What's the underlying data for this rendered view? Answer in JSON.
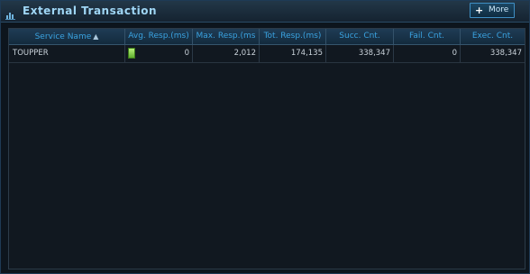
{
  "panel": {
    "title": "External Transaction",
    "more_button": {
      "icon": "plus-icon",
      "label": "More"
    }
  },
  "table": {
    "columns": [
      {
        "label": "Service Name",
        "sorted": "ascending"
      },
      {
        "label": "Avg. Resp.(ms)"
      },
      {
        "label": "Max. Resp.(ms"
      },
      {
        "label": "Tot. Resp.(ms)"
      },
      {
        "label": "Succ. Cnt."
      },
      {
        "label": "Fail. Cnt."
      },
      {
        "label": "Exec. Cnt."
      }
    ],
    "rows": [
      {
        "service_name": "TOUPPER",
        "avg_resp": "0",
        "avg_resp_bar": "green",
        "max_resp": "2,012",
        "tot_resp": "174,135",
        "succ_cnt": "338,347",
        "fail_cnt": "0",
        "exec_cnt": "338,347"
      }
    ]
  },
  "colors": {
    "title_text": "#9fd6f5",
    "header_text": "#3aa2e0",
    "bar_green": "#7ed04a"
  }
}
